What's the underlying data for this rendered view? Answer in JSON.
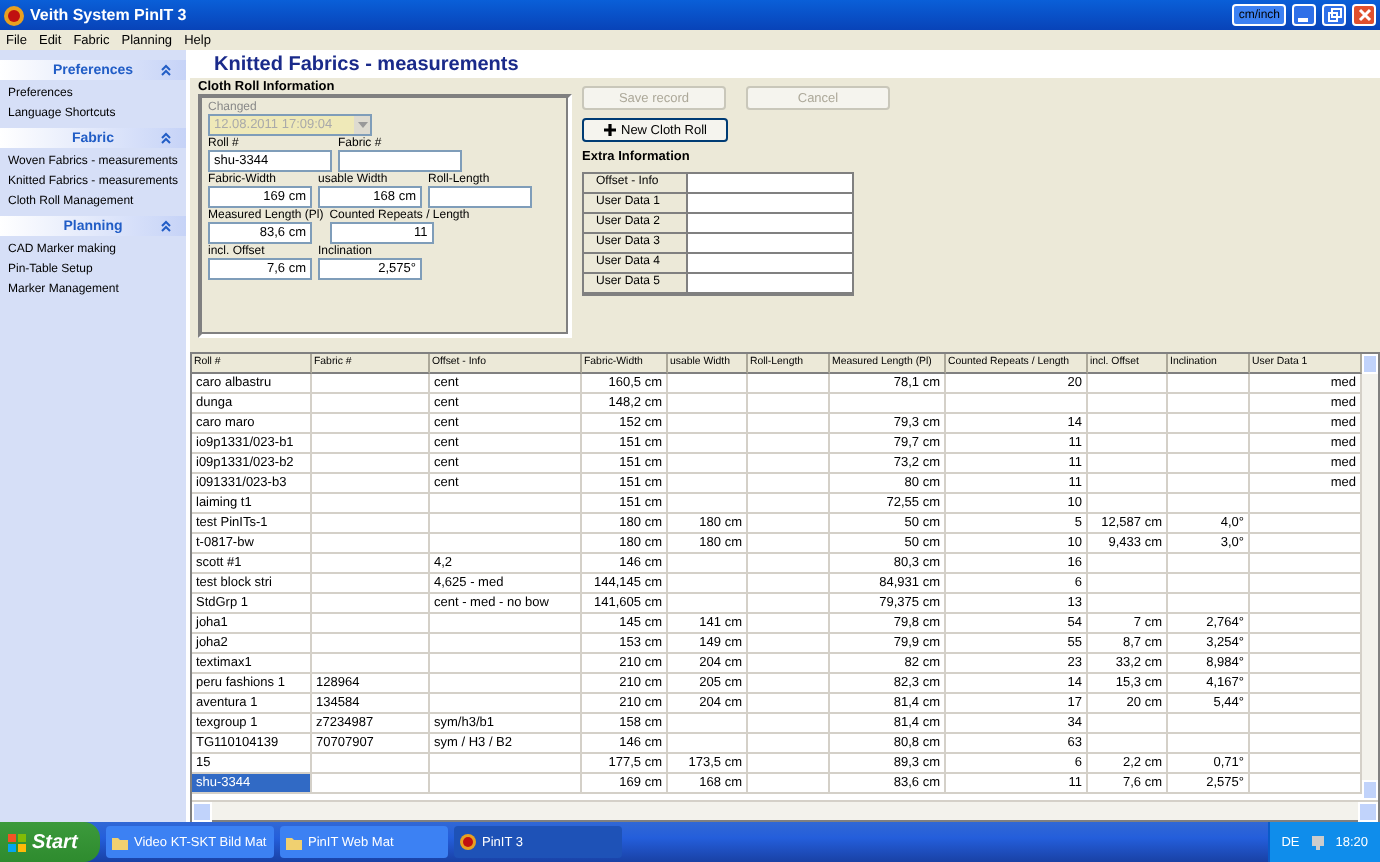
{
  "window": {
    "title": "Veith System PinIT 3",
    "unit_button": "cm/inch"
  },
  "menu": [
    "File",
    "Edit",
    "Fabric",
    "Planning",
    "Help"
  ],
  "sidebar": [
    {
      "title": "Preferences",
      "expanded": true,
      "items": [
        "Preferences",
        "Language Shortcuts"
      ]
    },
    {
      "title": "Fabric",
      "expanded": true,
      "items": [
        "Woven Fabrics - measurements",
        "Knitted Fabrics - measurements",
        "Cloth Roll Management"
      ]
    },
    {
      "title": "Planning",
      "expanded": true,
      "items": [
        "CAD Marker making",
        "Pin-Table Setup",
        "Marker Management"
      ]
    }
  ],
  "page_title": "Knitted Fabrics - measurements",
  "cloth_roll": {
    "title": "Cloth Roll Information",
    "changed": {
      "label": "Changed",
      "value": "12.08.2011 17:09:04",
      "disabled": true
    },
    "rows": [
      [
        {
          "label": "Roll #",
          "value": "shu-3344"
        },
        {
          "label": "Fabric #"
        }
      ],
      [
        {
          "label": "Fabric-Width",
          "value": "169 cm"
        },
        {
          "label": "usable Width",
          "value": "168 cm"
        },
        {
          "label": "Roll-Length"
        }
      ],
      [
        {
          "label": "Measured Length (Pl)",
          "value": "83,6 cm"
        },
        {
          "label": "Counted Repeats / Length",
          "value": "11"
        }
      ],
      [
        {
          "label": "incl. Offset",
          "value": "7,6 cm"
        },
        {
          "label": "Inclination",
          "value": "2,575°"
        }
      ]
    ]
  },
  "actions": [
    {
      "label": "Save record",
      "disabled": true
    },
    {
      "label": "Cancel",
      "disabled": true
    }
  ],
  "new_button": "New Cloth Roll",
  "extra": {
    "title": "Extra Information",
    "rows": [
      "Offset - Info",
      "User Data 1",
      "User Data 2",
      "User Data 3",
      "User Data 4",
      "User Data 5"
    ]
  },
  "table": {
    "columns": [
      "Roll #",
      "Fabric #",
      "Offset - Info",
      "Fabric-Width",
      "usable Width",
      "Roll-Length",
      "Measured Length (Pl)",
      "Counted Repeats / Length",
      "incl. Offset",
      "Inclination",
      "User Data 1"
    ],
    "rows": [
      {
        "selected": false,
        "cells": [
          "caro albastru",
          null,
          "cent",
          "160,5 cm",
          null,
          null,
          "78,1 cm",
          "20",
          null,
          null,
          "med"
        ]
      },
      {
        "selected": false,
        "cells": [
          "dunga",
          null,
          "cent",
          "148,2 cm",
          null,
          null,
          null,
          null,
          null,
          null,
          "med"
        ]
      },
      {
        "selected": false,
        "cells": [
          "caro maro",
          null,
          "cent",
          "152 cm",
          null,
          null,
          "79,3 cm",
          "14",
          null,
          null,
          "med"
        ]
      },
      {
        "selected": false,
        "cells": [
          "io9p1331/023-b1",
          null,
          "cent",
          "151 cm",
          null,
          null,
          "79,7 cm",
          "11",
          null,
          null,
          "med"
        ]
      },
      {
        "selected": false,
        "cells": [
          "i09p1331/023-b2",
          null,
          "cent",
          "151 cm",
          null,
          null,
          "73,2 cm",
          "11",
          null,
          null,
          "med"
        ]
      },
      {
        "selected": false,
        "cells": [
          "i091331/023-b3",
          null,
          "cent",
          "151 cm",
          null,
          null,
          "80 cm",
          "11",
          null,
          null,
          "med"
        ]
      },
      {
        "selected": false,
        "cells": [
          "laiming t1",
          null,
          null,
          "151 cm",
          null,
          null,
          "72,55 cm",
          "10",
          null,
          null,
          null
        ]
      },
      {
        "selected": false,
        "cells": [
          "test PinITs-1",
          null,
          null,
          "180 cm",
          "180 cm",
          null,
          "50 cm",
          "5",
          "12,587 cm",
          "4,0°",
          null
        ]
      },
      {
        "selected": false,
        "cells": [
          "t-0817-bw",
          null,
          null,
          "180 cm",
          "180 cm",
          null,
          "50 cm",
          "10",
          "9,433 cm",
          "3,0°",
          null
        ]
      },
      {
        "selected": false,
        "cells": [
          "scott #1",
          null,
          "4,2",
          "146 cm",
          null,
          null,
          "80,3 cm",
          "16",
          null,
          null,
          null
        ]
      },
      {
        "selected": false,
        "cells": [
          "test block stri",
          null,
          "4,625 - med",
          "144,145 cm",
          null,
          null,
          "84,931 cm",
          "6",
          null,
          null,
          null
        ]
      },
      {
        "selected": false,
        "cells": [
          "StdGrp 1",
          null,
          "cent - med - no bow",
          "141,605 cm",
          null,
          null,
          "79,375 cm",
          "13",
          null,
          null,
          null
        ]
      },
      {
        "selected": false,
        "cells": [
          "joha1",
          null,
          null,
          "145 cm",
          "141 cm",
          null,
          "79,8 cm",
          "54",
          "7 cm",
          "2,764°",
          null
        ]
      },
      {
        "selected": false,
        "cells": [
          "joha2",
          null,
          null,
          "153 cm",
          "149 cm",
          null,
          "79,9 cm",
          "55",
          "8,7 cm",
          "3,254°",
          null
        ]
      },
      {
        "selected": false,
        "cells": [
          "textimax1",
          null,
          null,
          "210 cm",
          "204 cm",
          null,
          "82 cm",
          "23",
          "33,2 cm",
          "8,984°",
          null
        ]
      },
      {
        "selected": false,
        "cells": [
          "peru fashions 1",
          "128964",
          null,
          "210 cm",
          "205 cm",
          null,
          "82,3 cm",
          "14",
          "15,3 cm",
          "4,167°",
          null
        ]
      },
      {
        "selected": false,
        "cells": [
          "aventura 1",
          "134584",
          null,
          "210 cm",
          "204 cm",
          null,
          "81,4 cm",
          "17",
          "20 cm",
          "5,44°",
          null
        ]
      },
      {
        "selected": false,
        "cells": [
          "texgroup 1",
          "z7234987",
          "sym/h3/b1",
          "158 cm",
          null,
          null,
          "81,4 cm",
          "34",
          null,
          null,
          null
        ]
      },
      {
        "selected": false,
        "cells": [
          "TG110104139",
          "70707907",
          "sym / H3 / B2",
          "146 cm",
          null,
          null,
          "80,8 cm",
          "63",
          null,
          null,
          null
        ]
      },
      {
        "selected": false,
        "cells": [
          "15",
          null,
          null,
          "177,5 cm",
          "173,5 cm",
          null,
          "89,3 cm",
          "6",
          "2,2 cm",
          "0,71°",
          null
        ]
      },
      {
        "selected": true,
        "cells": [
          "shu-3344",
          null,
          null,
          "169 cm",
          "168 cm",
          null,
          "83,6 cm",
          "11",
          "7,6 cm",
          "2,575°",
          null
        ]
      }
    ]
  },
  "taskbar": {
    "start": "Start",
    "tasks": [
      {
        "label": "Video KT-SKT Bild Mat",
        "kind": "folder",
        "selected": false
      },
      {
        "label": "PinIT Web Mat",
        "kind": "folder",
        "selected": false
      },
      {
        "label": "PinIT 3",
        "kind": "app",
        "selected": true
      }
    ],
    "language": "DE",
    "time": "18:20"
  }
}
